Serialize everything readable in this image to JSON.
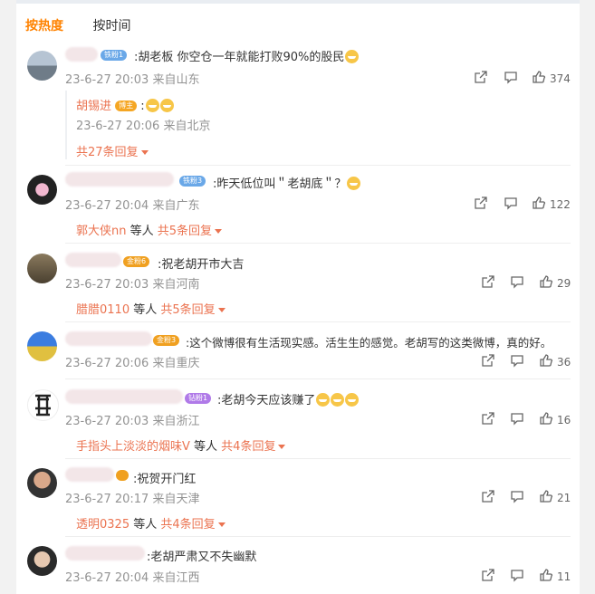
{
  "sort": {
    "hot": "按热度",
    "time": "按时间"
  },
  "comments": [
    {
      "badge": "铁粉1",
      "text": ":胡老板  你空仓一年就能打败90%的股民",
      "time": "23-6-27 20:03",
      "location": "来自山东",
      "likes": "374",
      "sub": {
        "name": "胡锡进",
        "tag": "博主",
        "text": ":",
        "time": "23-6-27 20:06",
        "location": "来自北京"
      },
      "more": "共27条回复"
    },
    {
      "badge": "铁粉3",
      "text": ":昨天低位叫＂老胡底＂？",
      "time": "23-6-27 20:04",
      "location": "来自广东",
      "likes": "122",
      "reply_name": "郭大侠nn",
      "reply_mid": " 等人 ",
      "more": "共5条回复"
    },
    {
      "badge": "金粉6",
      "text": ":祝老胡开市大吉",
      "time": "23-6-27 20:03",
      "location": "来自河南",
      "likes": "29",
      "reply_name": "腊腊0110",
      "reply_mid": " 等人 ",
      "more": "共5条回复"
    },
    {
      "badge": "金粉3",
      "text": ":这个微博很有生活现实感。活生生的感觉。老胡写的这类微博，真的好。",
      "time": "23-6-27 20:06",
      "location": "来自重庆",
      "likes": "36"
    },
    {
      "badge": "钻粉1",
      "text": ":老胡今天应该赚了",
      "time": "23-6-27 20:03",
      "location": "来自浙江",
      "likes": "16",
      "reply_name": "手指头上淡淡的烟味V",
      "reply_mid": " 等人 ",
      "more": "共4条回复"
    },
    {
      "text": ":祝贺开门红",
      "time": "23-6-27 20:17",
      "location": "来自天津",
      "likes": "21",
      "reply_name": "透明0325",
      "reply_mid": " 等人 ",
      "more": "共4条回复"
    },
    {
      "text": ":老胡严肃又不失幽默",
      "time": "23-6-27 20:04",
      "location": "来自江西",
      "likes": "11"
    }
  ]
}
